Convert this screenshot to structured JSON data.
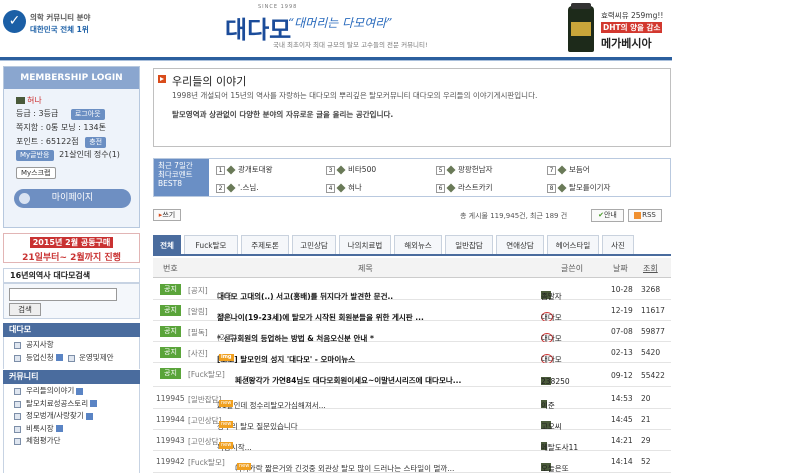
{
  "header": {
    "logo_left_line1": "의학 커뮤니티 분야",
    "logo_left_line2": "대한민국 전체 1위",
    "since": "SINCE 1998",
    "brand_name": "대다모",
    "slogan": "“대머리는 다모여라”",
    "brand_desc": "국내 최초이자 최대 규모의 탈모 고수들의 전문 커뮤니티!",
    "ad_line1": "효력씨유 259mg!!",
    "ad_line2": "DHT의 양을 감소",
    "ad_line3": "메가베시아"
  },
  "login": {
    "title": "MEMBERSHIP LOGIN",
    "nickname": "혀나",
    "level_label": "등급 : 3등급",
    "logout": "로그아웃",
    "stats": "쪽지함 : 0통   모닝 : 134톤",
    "points": "포인트 : 65122점",
    "charge": "충전",
    "my_post_label": "My글반응",
    "my_post_text": "21살인데 정수(1)",
    "scrap": "My스크랩",
    "mypage": "마이페이지"
  },
  "banner": {
    "line1": "2015년 2월 공동구매",
    "line2": "21일부터~ 2월까지 진행"
  },
  "search": {
    "title": "16년의역사 대다모검색",
    "button": "검색"
  },
  "nav": {
    "section1_title": "대다모",
    "section1_items": [
      "공지사항",
      "등업신청",
      "운영및제안"
    ],
    "section2_title": "커뮤니티",
    "section2_items": [
      "우리들의이야기",
      "탈모치료성공스토리",
      "정모벙개/사랑찾기",
      "비룩시장",
      "체험평가단"
    ]
  },
  "intro": {
    "title": "우리들의 이야기",
    "desc1": "1998년 개설되어 15년의 역사를 자랑하는 대다모의 뿌리깊은 탈모커뮤니티 대다모의 우리들의 이야기게시판입니다.",
    "desc2": "탈모영역과 상관없이 다양한 분야의 자유로운 글을 올리는 공간입니다."
  },
  "best": {
    "label_line1": "최근 7일간",
    "label_line2": "최다코멘트",
    "label_line3": "BEST8",
    "items": [
      "광개토대왕",
      "비타500",
      "팡팡헌남자",
      "보듬어",
      "'.스님.",
      "혀나",
      "라스트카키",
      "탈모를이기자"
    ]
  },
  "toolbar": {
    "write": "쓰기",
    "stats": "총 게시물 119,945건, 최근 189 건",
    "guide": "안내",
    "rss": "RSS"
  },
  "tabs": [
    "전체",
    "Fuck탈모",
    "주제토론",
    "고민상담",
    "나의치료법",
    "해외뉴스",
    "일반잡담",
    "연애상담",
    "헤어스타일",
    "사진"
  ],
  "table": {
    "headers": {
      "num": "번호",
      "title": "제목",
      "author": "글쓴이",
      "date": "날짜",
      "views": "조회"
    },
    "rows": [
      {
        "num": "공지",
        "cat": "[공지]",
        "title": "대다모 고대의(..) 서고(홍배)를 뒤지다가 발견한 문건..",
        "count": "(59)",
        "author": "좀말자",
        "date": "10-28",
        "views": "3268"
      },
      {
        "num": "공지",
        "cat": "[알림]",
        "title": "젊은나이(19-23세)에 탈모가 시작된 회원분들을 위한 게시판 ...",
        "count": "(96)",
        "author": "대다모",
        "date": "12-19",
        "views": "11617"
      },
      {
        "num": "공지",
        "cat": "[필독]",
        "title": "* 신규회원의 등업하는 방법 & 처음오신분 안내 *",
        "count": "(265)",
        "author": "대다모",
        "date": "07-08",
        "views": "59877"
      },
      {
        "num": "공지",
        "cat": "[사진]",
        "title": "[보도] 탈모인의 성지 '대다모' - 오마이뉴스",
        "count": "(1)",
        "author": "대다모",
        "date": "02-13",
        "views": "5420"
      },
      {
        "num": "공지",
        "cat": "[Fuck탈모]",
        "title": "페션왕각가 가연84님도 대다모회원이세요~이말년시리즈에 대다모나...",
        "count": "(45)",
        "author": "238250",
        "date": "09-12",
        "views": "55422"
      },
      {
        "num": "119945",
        "cat": "[일반잡담]",
        "title": "21살인데 정수리탈모가심해져서...",
        "count": "(1)",
        "author": "이준",
        "date": "14:53",
        "views": "20"
      },
      {
        "num": "119944",
        "cat": "[고민상담]",
        "title": "정수리 탈모 질문있습니다",
        "count": "",
        "author": "고오씨",
        "date": "14:45",
        "views": "21"
      },
      {
        "num": "119943",
        "cat": "[고민상담]",
        "title": "복용시작...",
        "count": "",
        "author": "메탈도사11",
        "date": "14:21",
        "views": "29"
      },
      {
        "num": "119942",
        "cat": "[Fuck탈모]",
        "title": "머리카락 짧은거와 긴것중 외관상 탈모 많이 드러나는 스타일이 멀까...",
        "count": "(2)",
        "author": "오늘은또",
        "date": "14:14",
        "views": "52"
      }
    ]
  }
}
